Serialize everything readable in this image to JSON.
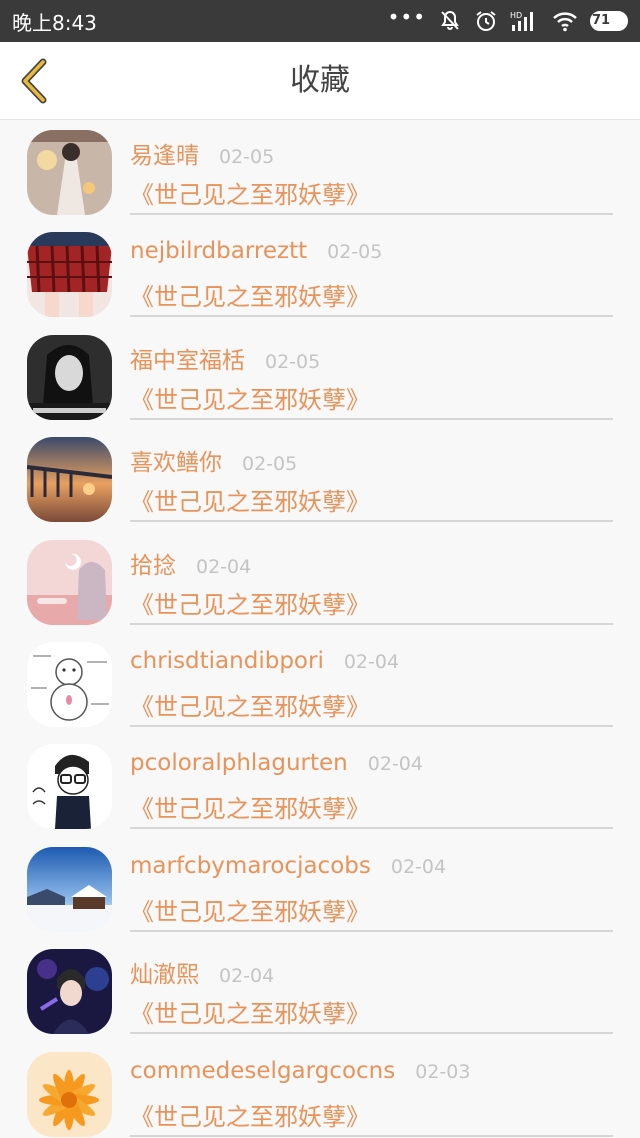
{
  "status_bar": {
    "time": "晚上8:43",
    "icons": [
      "more-dots-icon",
      "notifications-off-icon",
      "alarm-icon",
      "hd-signal-icon",
      "wifi-icon",
      "battery-icon"
    ],
    "hd_label": "HD",
    "battery": "71"
  },
  "header": {
    "title": "收藏",
    "back_icon": "chevron-left-icon",
    "accent": "#e8b93a"
  },
  "colors": {
    "name": "#e8935a",
    "date": "#c4c4c4",
    "divider": "#d6d6d6"
  },
  "items": [
    {
      "name": "易逢晴",
      "date": "02-05",
      "title": "《世己见之至邪妖孽》",
      "avatar": "avatar-girl-lantern"
    },
    {
      "name": "nejbilrdbarreztt",
      "date": "02-05",
      "title": "《世己见之至邪妖孽》",
      "avatar": "avatar-plaid-skirt"
    },
    {
      "name": "福中室福栝",
      "date": "02-05",
      "title": "《世己见之至邪妖孽》",
      "avatar": "avatar-bw-girl"
    },
    {
      "name": "喜欢鳝你",
      "date": "02-05",
      "title": "《世己见之至邪妖孽》",
      "avatar": "avatar-pier-sunset"
    },
    {
      "name": "拾捻",
      "date": "02-04",
      "title": "《世己见之至邪妖孽》",
      "avatar": "avatar-pink-anime"
    },
    {
      "name": "chrisdtiandibpori",
      "date": "02-04",
      "title": "《世己见之至邪妖孽》",
      "avatar": "avatar-snowman-cartoon"
    },
    {
      "name": "pcoloralphlagurten",
      "date": "02-04",
      "title": "《世己见之至邪妖孽》",
      "avatar": "avatar-glasses-boy-cartoon"
    },
    {
      "name": "marfcbymarocjacobs",
      "date": "02-04",
      "title": "《世己见之至邪妖孽》",
      "avatar": "avatar-snow-cabin"
    },
    {
      "name": "灿澈熙",
      "date": "02-04",
      "title": "《世己见之至邪妖孽》",
      "avatar": "avatar-purple-boy"
    },
    {
      "name": "commedeselgargcocns",
      "date": "02-03",
      "title": "《世己见之至邪妖孽》",
      "avatar": "avatar-orange-flower"
    }
  ]
}
